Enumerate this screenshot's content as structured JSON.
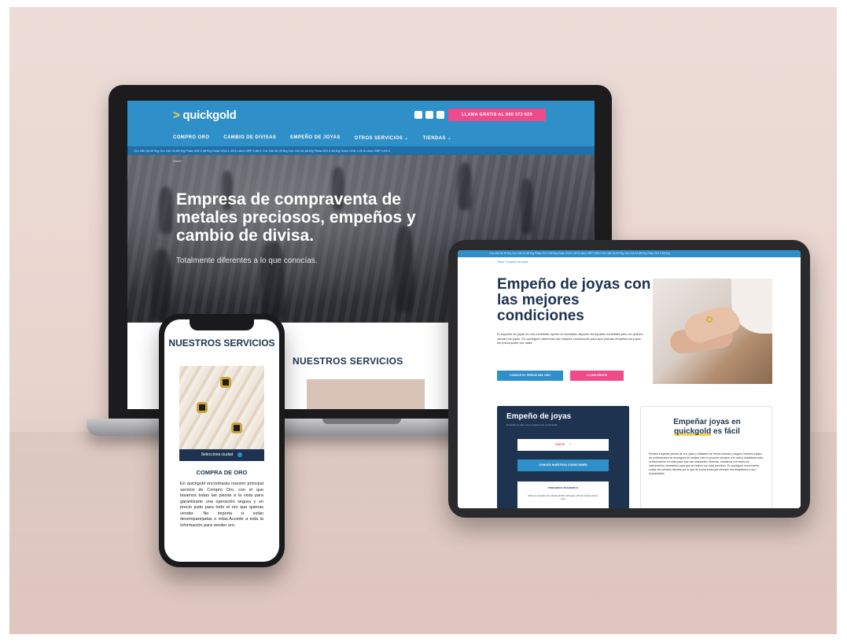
{
  "laptop": {
    "logo": "quickgold",
    "logo_arrow": ">",
    "call_button": "LLAMA GRATIS AL 900 373 629",
    "nav": [
      "COMPRO ORO",
      "CAMBIO DE DIVISAS",
      "EMPEÑO DE JOYAS",
      "OTROS SERVICIOS ⌄",
      "TIENDAS ⌄"
    ],
    "ticker": "Oro 18k 36,49 €/g   Oro 24k 54,88 €/g   Plata 925 0,58 €/g   Dólar USA 1,05 $   Libra GBP 0,85 £   Oro 18k 36,49 €/g   Oro 24k 54,88 €/g   Plata 925 0,58 €/g   Dólar USA 1,05 $   Libra GBP 0,85 £",
    "breadcrumb": "Home",
    "hero_title": "Empresa de compraventa de metales preciosos, empeños y cambio de divisa.",
    "hero_subtitle": "Totalmente diferentes a lo que conocías.",
    "services_title": "NUESTROS SERVICIOS"
  },
  "tablet": {
    "ticker": "Oro 18k 36,49 €/g   Oro 24k 54,88 €/g   Plata 925 0,58 €/g   Dólar USA 1,05 $   Libra GBP 0,85 £   Oro 18k 36,49 €/g   Oro 24k 54,88 €/g   Plata 925 0,58 €/g",
    "breadcrumb": "Home / Empeño de joyas",
    "title": "Empeño de joyas con las mejores condiciones",
    "body": "El empeño de joyas es una excelente opción si necesitas disponer de liquidez inmediata pero no quieres vender tus joyas. En quickgold ofrecemos las mejores condiciones para que puedas empeñar tus joyas sin preocuparte por nada.",
    "btn_primary": "CONOCE EL PRECIO DEL ORO",
    "btn_secondary": "LLAMA GRATIS",
    "dark_card": {
      "title": "Empeño de joyas",
      "subtitle": "Descubre el valor de tu empeño con el simulador",
      "select_value": "NUEVE",
      "select_chevron": "^",
      "button": "CONOCE NUESTRAS CONDICIONES",
      "example_title": "PONGAMOS UN EJEMPLO",
      "example_text": "Para un empeño con interés al 0% mensual y 2% de interés primer mes"
    },
    "light_card": {
      "title_line1": "Empeñar joyas en",
      "title_brand": "quickgold",
      "title_line2": " es fácil",
      "body": "Puedes empeñar piezas de oro, plata y brillantes de forma cómoda y segura. Nuestro equipo de profesionales se encargará de realizar todo el proceso siempre a la vista y detallando toda la información en cada paso que van realizando. Además, contamos con todos los instrumentos necesarios para que se realice con total precisión. En quickgold nos encanta cuidar de nuestros clientes por lo que de forma exclusiva siempre nos adaptamos a sus necesidades."
    }
  },
  "phone": {
    "title": "NUESTROS SERVICIOS",
    "select_city": "Selecciona ciudad",
    "section_title": "COMPRA DE ORO",
    "body": "En quickgold encontrarás nuestro principal servicio de Compro Oro, con el que tasamos todas las piezas a la vista para garantizarte una operación segura y un precio justo para todo el oro que quieras vender. No importa si están desemparejadas o rotas.Accede a toda la información para vender oro."
  },
  "colors": {
    "brand_blue": "#2f8fc9",
    "navy": "#1d3350",
    "pink": "#ef4b8b",
    "yellow": "#f7d34a",
    "background": "#eddcd7"
  }
}
